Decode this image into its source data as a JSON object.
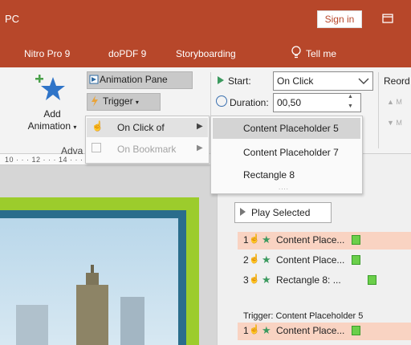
{
  "titlebar": {
    "title": "PC",
    "sign_in": "Sign in",
    "restore_icon": "restore-window-icon"
  },
  "tabs": [
    "Nitro Pro 9",
    "doPDF 9",
    "Storyboarding",
    "Tell me"
  ],
  "ribbon": {
    "add_animation": "Add Animation",
    "add_animation_line1": "Add",
    "add_animation_line2": "Animation",
    "advanced_group": "Adva",
    "animation_pane": "Animation Pane",
    "trigger": "Trigger",
    "start_label": "Start:",
    "start_value": "On Click",
    "duration_label": "Duration:",
    "duration_value": "00,50",
    "reorder": "Reord",
    "move_earlier": "M",
    "move_later": "M"
  },
  "ruler": "10 · · · 12 · · · 14 · · · 16 ·",
  "trigger_menu": {
    "on_click_of": "On Click of",
    "on_bookmark": "On Bookmark"
  },
  "submenu": {
    "items": [
      "Content Placeholder 5",
      "Content Placeholder 7",
      "Rectangle 8"
    ],
    "more": "...."
  },
  "animation_pane": {
    "play_selected": "Play Selected",
    "items": [
      {
        "num": "1",
        "label": "Content Place..."
      },
      {
        "num": "2",
        "label": "Content Place..."
      },
      {
        "num": "3",
        "label": "Rectangle 8: ..."
      }
    ],
    "trigger_header": "Trigger: Content Placeholder 5",
    "trigger_items": [
      {
        "num": "1",
        "label": "Content Place..."
      }
    ]
  },
  "colors": {
    "accent": "#b7472a",
    "selected_row": "#f9d3c2",
    "effect_star": "#3c9a5f"
  }
}
